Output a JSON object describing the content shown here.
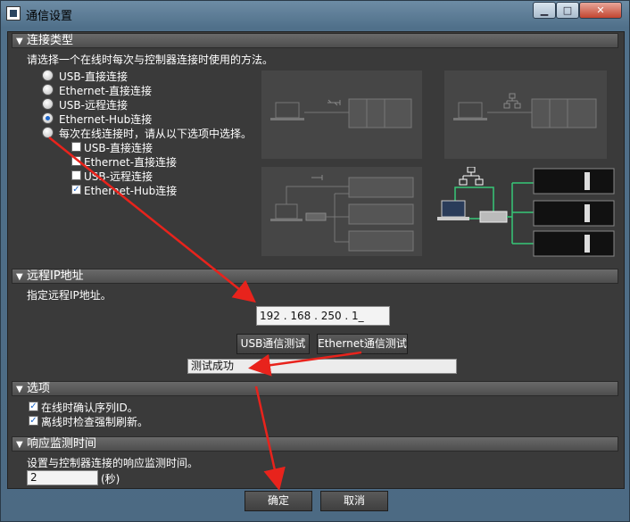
{
  "window": {
    "title": "通信设置",
    "min_glyph": "▁",
    "max_glyph": "□",
    "close_glyph": "✕"
  },
  "sections": {
    "connection_type": {
      "header": "连接类型",
      "desc": "请选择一个在线时每次与控制器连接时使用的方法。",
      "options": [
        "USB-直接连接",
        "Ethernet-直接连接",
        "USB-远程连接",
        "Ethernet-Hub连接",
        "每次在线连接时，请从以下选项中选择。"
      ],
      "selected_index": 3,
      "sub_options": [
        {
          "label": "USB-直接连接",
          "checked": false
        },
        {
          "label": "Ethernet-直接连接",
          "checked": false
        },
        {
          "label": "USB-远程连接",
          "checked": false
        },
        {
          "label": "Ethernet-Hub连接",
          "checked": true
        }
      ]
    },
    "remote_ip": {
      "header": "远程IP地址",
      "desc": "指定远程IP地址。",
      "ip_value": "192 . 168 . 250 . 1_",
      "usb_test_label": "USB通信测试",
      "eth_test_label": "Ethernet通信测试",
      "result_text": "测试成功"
    },
    "options": {
      "header": "选项",
      "items": [
        {
          "label": "在线时确认序列ID。",
          "checked": true
        },
        {
          "label": "离线时检查强制刷新。",
          "checked": true
        }
      ]
    },
    "response": {
      "header": "响应监测时间",
      "desc": "设置与控制器连接的响应监测时间。",
      "value": "2",
      "unit": "(秒)"
    }
  },
  "footer": {
    "ok_label": "确定",
    "cancel_label": "取消"
  },
  "colors": {
    "annotation_arrow": "#e8231c",
    "hub_link": "#36c777",
    "panel": "#3a3a3a"
  },
  "icons": {
    "usb": "usb-icon",
    "network": "network-icon",
    "collapse": "▼"
  }
}
